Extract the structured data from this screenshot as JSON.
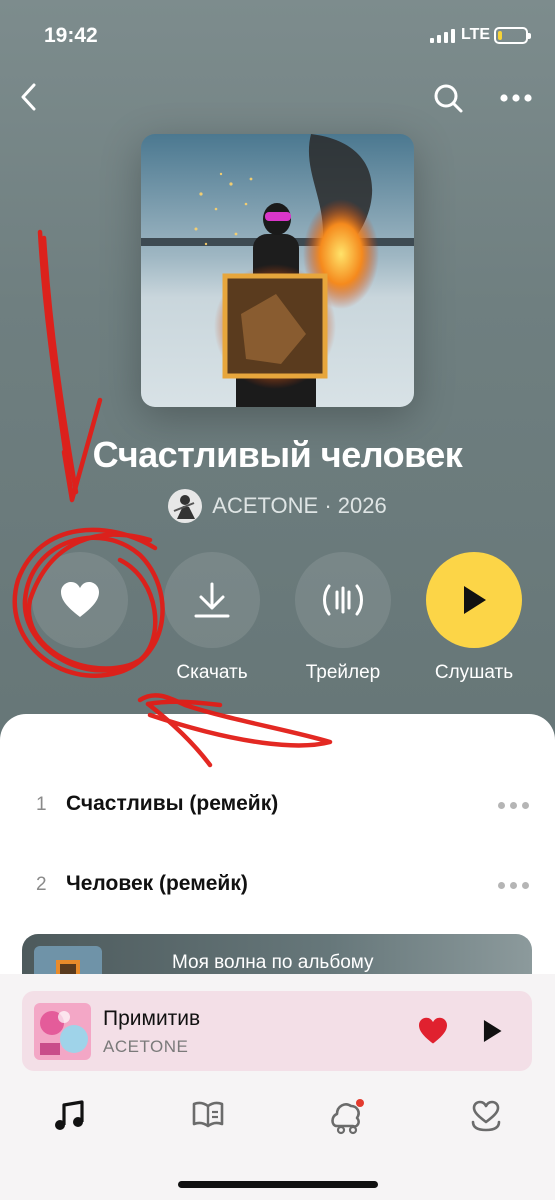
{
  "status_bar": {
    "time": "19:42",
    "network": "LTE",
    "battery_level": 0.15
  },
  "header": {
    "back_icon": "chevron-left-icon",
    "search_icon": "search-icon",
    "more_icon": "more-horizontal-icon"
  },
  "album": {
    "title": "Счастливый человек",
    "artist_line": "ACETONE · 2026"
  },
  "actions": {
    "like_icon": "heart-icon",
    "download_label": "Скачать",
    "trailer_label": "Трейлер",
    "listen_label": "Слушать"
  },
  "tracks": [
    {
      "number": "1",
      "title": "Счастливы (ремейк)"
    },
    {
      "number": "2",
      "title": "Человек (ремейк)"
    }
  ],
  "wave_card": {
    "label": "Моя волна по альбому"
  },
  "mini_player": {
    "title": "Примитив",
    "artist": "ACETONE",
    "liked": true
  },
  "tabs": [
    "music-note-icon",
    "library-book-icon",
    "kids-icon",
    "heart-collection-icon"
  ],
  "colors": {
    "accent_yellow": "#fcd547",
    "like_red": "#e0212f",
    "annotation_red": "#e21d17",
    "hero_bg": "#6f7f80"
  }
}
